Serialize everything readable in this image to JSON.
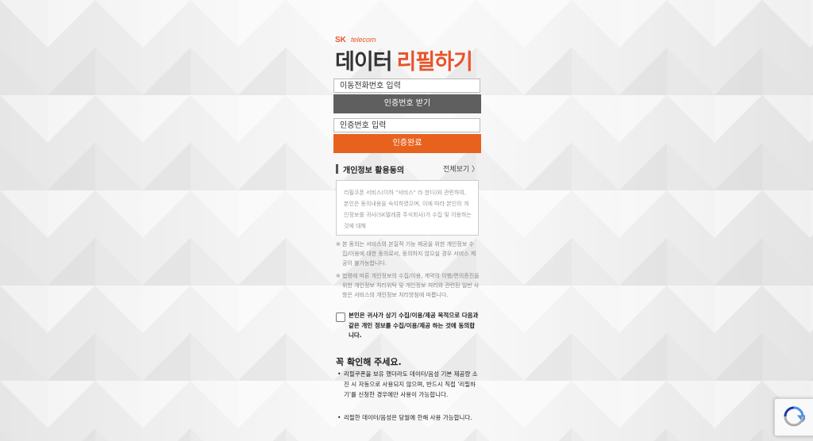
{
  "brand": {
    "sk": "SK",
    "telecom": "telecom"
  },
  "title": {
    "part1": "데이터",
    "part2": "리필하기"
  },
  "phone_input": {
    "placeholder": "이동전화번호 입력"
  },
  "request_code_button": "인증번호 받기",
  "code_input": {
    "placeholder": "인증번호 입력"
  },
  "verify_button": "인증완료",
  "privacy": {
    "title": "개인정보 활용동의",
    "view_all": "전체보기 〉",
    "agreement_text": "리필쿠폰 서비스(이하 \"서비스\" 라 한다)와 관련하여, 본인은 동의내용을 숙지하였으며, 이에 따라 본인의 개인정보를 귀사(SK텔레콤 주식회사)가 수집 및 이용하는 것에 대해"
  },
  "notes": [
    {
      "mark": "※",
      "text": "본 동의는 서비스의 본질적 기능 제공을 위한 개인정보 수집/이용에 대한 동의로서, 동의하지 않으실 경우 서비스 제공이 불가능합니다."
    },
    {
      "mark": "※",
      "text": "법령에 따른 개인정보의 수집/이용, 계약의 이행/편의증진을 위한 개인정보 처리위탁 및 개인정보 처리와 관련된 일반 사항은 서비스의 개인정보 처리방침에 따릅니다."
    }
  ],
  "consent_checkbox": "본인은 귀사가 상기 수집/이용/제공 목적으로 다음과 같은 개인 정보를 수집/이용/제공 하는 것에 동의합니다.",
  "confirm": {
    "title": "꼭 확인해 주세요.",
    "bullets": [
      {
        "dot": "•",
        "text": "리필쿠폰을 보유 했더라도 데이터/음성 기본 제공량 소진 시 자동으로 사용되지 않으며, 반드시 직접 '리필하기'를 신청한 경우에만 사용이 가능합니다."
      },
      {
        "dot": "•",
        "text": "리필한 데이터/음성은 당월에 한해 사용 가능합니다."
      }
    ]
  },
  "colors": {
    "accent": "#e8621e",
    "gray_button": "#5f5f5f"
  }
}
